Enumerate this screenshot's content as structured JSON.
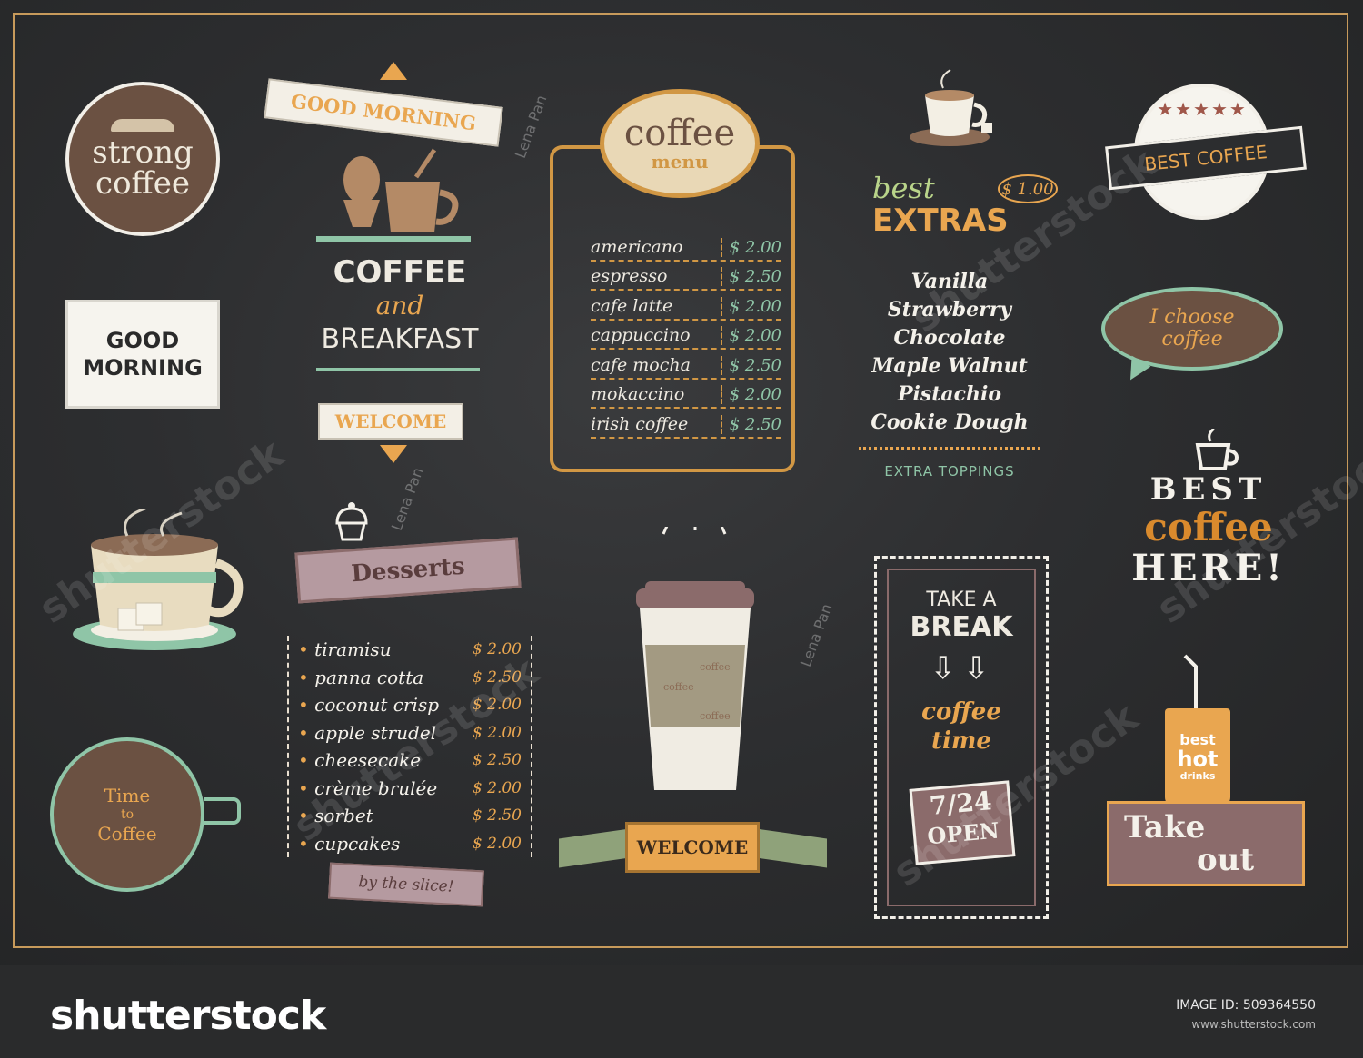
{
  "board": {
    "colors": {
      "accent_orange": "#e9a650",
      "accent_green": "#8fc5a7",
      "accent_brown": "#6b5142",
      "chalk_white": "#f4f1ea",
      "rose": "#b59aa0"
    }
  },
  "strong_badge": {
    "line1": "strong",
    "line2": "coffee",
    "icon": "mustache-icon"
  },
  "good_morning_sign": {
    "line1": "GOOD",
    "line2": "MORNING"
  },
  "time_clock": {
    "line1": "Time",
    "line2": "to",
    "line3": "Coffee",
    "icon": "clock-cup-icon"
  },
  "breakfast_block": {
    "ribbon": "GOOD MORNING",
    "title1": "COFFEE",
    "title2": "and",
    "title3": "BREAKFAST",
    "welcome": "WELCOME",
    "icon": "egg-and-cup-icon"
  },
  "coffee_menu": {
    "badge_line1": "coffee",
    "badge_line2": "menu",
    "items": [
      {
        "name": "americano",
        "price": "$ 2.00"
      },
      {
        "name": "espresso",
        "price": "$ 2.50"
      },
      {
        "name": "cafe latte",
        "price": "$ 2.00"
      },
      {
        "name": "cappuccino",
        "price": "$ 2.00"
      },
      {
        "name": "cafe  mocha",
        "price": "$ 2.50"
      },
      {
        "name": "mokaccino",
        "price": "$ 2.00"
      },
      {
        "name": "irish  coffee",
        "price": "$ 2.50"
      }
    ]
  },
  "extras": {
    "heading1": "best",
    "heading2": "EXTRAS",
    "price": "$ 1.00",
    "items": [
      "Vanilla",
      "Strawberry",
      "Chocolate",
      "Maple Walnut",
      "Pistachio",
      "Cookie Dough"
    ],
    "footer": "EXTRA TOPPINGS",
    "icon": "coffee-cup-saucer-icon"
  },
  "best_coffee_badge": {
    "stars": "★★★★★",
    "ribbon": "BEST COFFEE"
  },
  "choose_bubble": {
    "line1": "I choose",
    "line2": "coffee"
  },
  "best_coffee_here": {
    "line1": "BEST",
    "line2": "coffee",
    "line3": "HERE!"
  },
  "takeout": {
    "cup_line1": "best",
    "cup_line2": "hot",
    "cup_line3": "drinks",
    "sign_line1": "Take",
    "sign_line2": "out"
  },
  "desserts": {
    "ribbon": "Desserts",
    "items": [
      {
        "name": "tiramisu",
        "price": "$ 2.00"
      },
      {
        "name": "panna cotta",
        "price": "$ 2.50"
      },
      {
        "name": "coconut crisp",
        "price": "$ 2.00"
      },
      {
        "name": "apple strudel",
        "price": "$ 2.00"
      },
      {
        "name": "cheesecake",
        "price": "$ 2.50"
      },
      {
        "name": "crème brulée",
        "price": "$ 2.00"
      },
      {
        "name": "sorbet",
        "price": "$ 2.50"
      },
      {
        "name": "cupcakes",
        "price": "$ 2.00"
      }
    ],
    "slice": "by the slice!"
  },
  "takeaway_cup": {
    "sleeve1": "coffee",
    "sleeve2": "coffee",
    "sleeve3": "coffee",
    "welcome": "WELCOME"
  },
  "take_a_break": {
    "line1": "TAKE A",
    "line2": "BREAK",
    "arrows": "⇩⇩",
    "line3": "coffee",
    "line4": "time",
    "open1": "7/24",
    "open2": "OPEN"
  },
  "watermark": {
    "text": "shutterstock",
    "author": "Lena Pan"
  },
  "footer": {
    "logo": "shutterstock",
    "image_id": "IMAGE ID: 509364550",
    "url": "www.shutterstock.com"
  }
}
